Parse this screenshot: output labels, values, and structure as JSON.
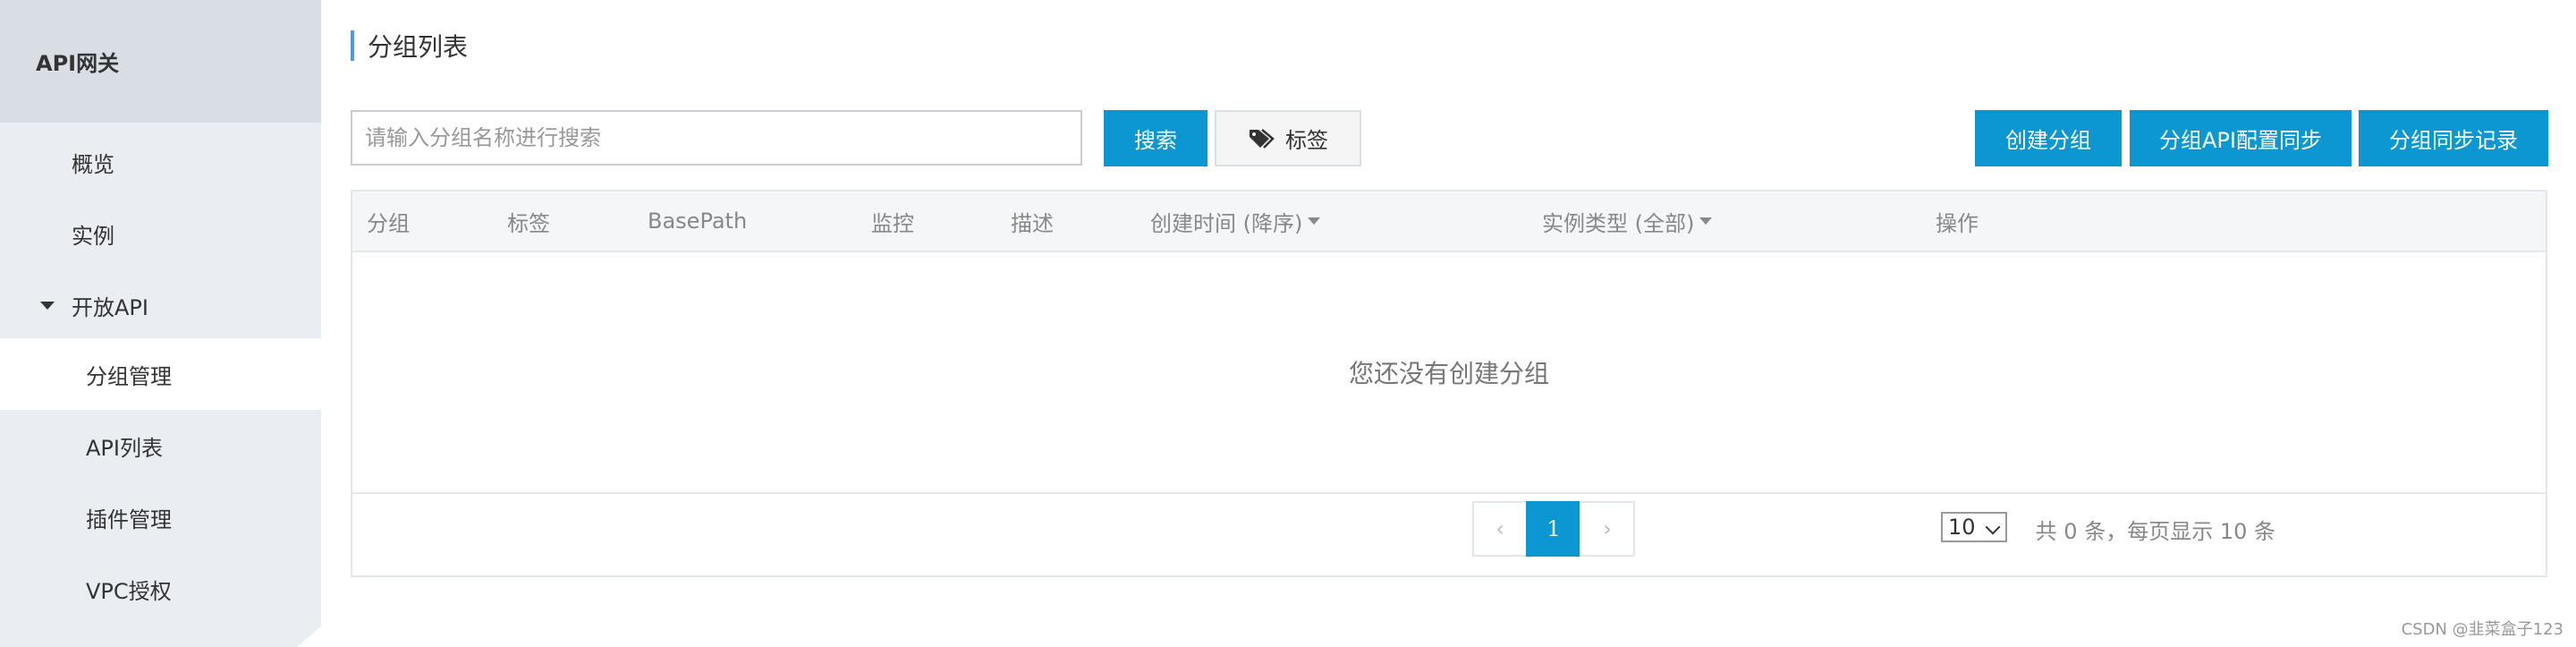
{
  "sidebar": {
    "title": "API网关",
    "items": [
      {
        "label": "概览"
      },
      {
        "label": "实例"
      },
      {
        "label": "开放API"
      },
      {
        "label": "分组管理"
      },
      {
        "label": "API列表"
      },
      {
        "label": "插件管理"
      },
      {
        "label": "VPC授权"
      }
    ]
  },
  "page": {
    "title": "分组列表"
  },
  "toolbar": {
    "search_placeholder": "请输入分组名称进行搜索",
    "search_label": "搜索",
    "tag_label": "标签",
    "create_label": "创建分组",
    "sync_config_label": "分组API配置同步",
    "sync_record_label": "分组同步记录"
  },
  "table": {
    "columns": [
      "分组",
      "标签",
      "BasePath",
      "监控",
      "描述",
      "创建时间 (降序)",
      "实例类型 (全部)",
      "操作"
    ],
    "empty_text": "您还没有创建分组"
  },
  "pagination": {
    "summary": "共 0 条，每页显示 10 条",
    "page_size": "10",
    "prev": "‹",
    "current": "1",
    "next": "›"
  },
  "watermark": "CSDN @韭菜盒子123",
  "colors": {
    "primary": "#0c97d2",
    "sidebar_bg": "#eaedf1",
    "accent_bar": "#4a9ed6"
  }
}
